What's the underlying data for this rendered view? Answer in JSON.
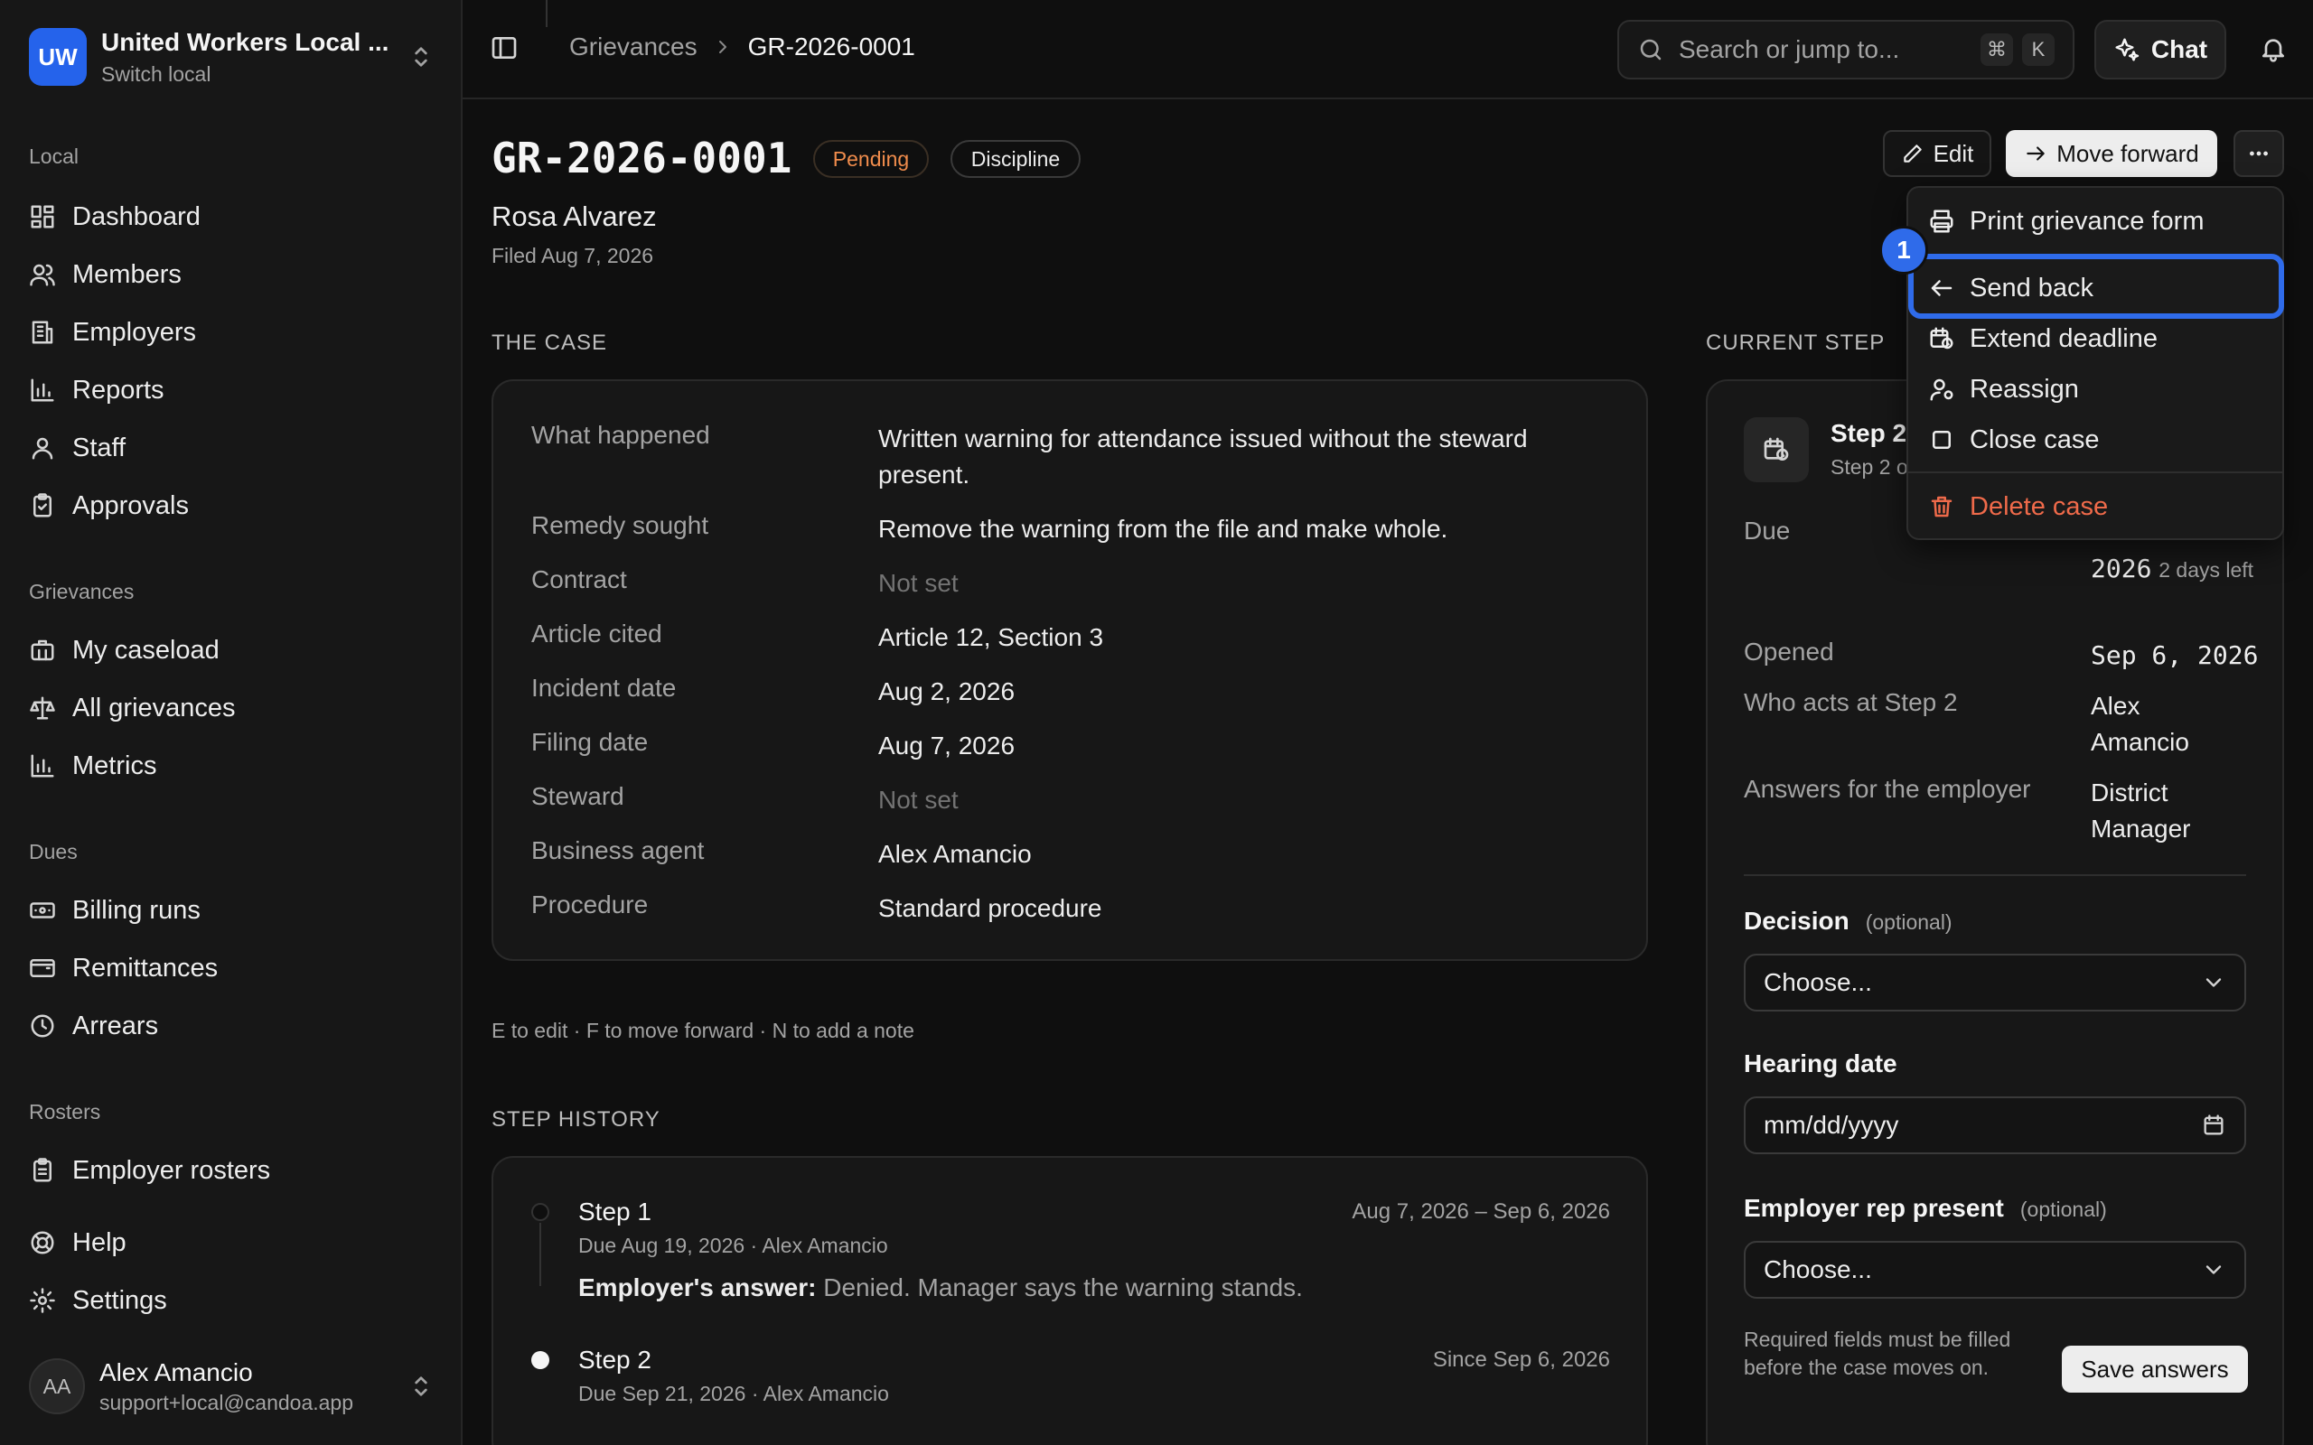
{
  "org": {
    "initials": "UW",
    "name": "United Workers Local ...",
    "switch_label": "Switch local"
  },
  "sidebar": {
    "local_label": "Local",
    "local_items": [
      {
        "label": "Dashboard",
        "icon": "dashboard-icon"
      },
      {
        "label": "Members",
        "icon": "members-icon"
      },
      {
        "label": "Employers",
        "icon": "building-icon"
      },
      {
        "label": "Reports",
        "icon": "bar-chart-icon"
      },
      {
        "label": "Staff",
        "icon": "user-icon"
      },
      {
        "label": "Approvals",
        "icon": "clipboard-check-icon"
      }
    ],
    "grievances_label": "Grievances",
    "grievance_items": [
      {
        "label": "My caseload",
        "icon": "briefcase-icon"
      },
      {
        "label": "All grievances",
        "icon": "scale-icon"
      },
      {
        "label": "Metrics",
        "icon": "bar-chart-icon"
      }
    ],
    "dues_label": "Dues",
    "dues_items": [
      {
        "label": "Billing runs",
        "icon": "banknote-icon"
      },
      {
        "label": "Remittances",
        "icon": "wallet-icon"
      },
      {
        "label": "Arrears",
        "icon": "clock-icon"
      }
    ],
    "rosters_label": "Rosters",
    "roster_items": [
      {
        "label": "Employer rosters",
        "icon": "clipboard-list-icon"
      }
    ],
    "footer_items": [
      {
        "label": "Help",
        "icon": "lifebuoy-icon"
      },
      {
        "label": "Settings",
        "icon": "gear-icon"
      }
    ]
  },
  "user": {
    "initials": "AA",
    "name": "Alex Amancio",
    "email": "support+local@candoa.app"
  },
  "topbar": {
    "breadcrumb_parent": "Grievances",
    "breadcrumb_current": "GR-2026-0001",
    "search_placeholder": "Search or jump to...",
    "kbd_mod": "⌘",
    "kbd_key": "K",
    "chat_label": "Chat"
  },
  "header": {
    "case_id": "GR-2026-0001",
    "status_badge": "Pending",
    "type_badge": "Discipline",
    "member_name": "Rosa Alvarez",
    "filed": "Filed Aug 7, 2026",
    "edit_label": "Edit",
    "move_forward_label": "Move forward"
  },
  "the_case": {
    "section_label": "THE CASE",
    "rows": [
      {
        "label": "What happened",
        "value": "Written warning for attendance issued without the steward present."
      },
      {
        "label": "Remedy sought",
        "value": "Remove the warning from the file and make whole."
      },
      {
        "label": "Contract",
        "value": "Not set"
      },
      {
        "label": "Article cited",
        "value": "Article 12, Section 3"
      },
      {
        "label": "Incident date",
        "value": "Aug 2, 2026"
      },
      {
        "label": "Filing date",
        "value": "Aug 7, 2026"
      },
      {
        "label": "Steward",
        "value": "Not set"
      },
      {
        "label": "Business agent",
        "value": "Alex Amancio"
      },
      {
        "label": "Procedure",
        "value": "Standard procedure"
      }
    ]
  },
  "shortcuts_hint": "E to edit · F to move forward · N to add a note",
  "step_history": {
    "section_label": "STEP HISTORY",
    "steps": [
      {
        "title": "Step 1",
        "sub": "Due Aug 19, 2026 · Alex Amancio",
        "dates": "Aug 7, 2026 – Sep 6, 2026",
        "answer_label": "Employer's answer:",
        "answer": "Denied. Manager says the warning stands."
      },
      {
        "title": "Step 2",
        "sub": "Due Sep 21, 2026 · Alex Amancio",
        "dates": "Since Sep 6, 2026"
      }
    ]
  },
  "current_step": {
    "section_label": "CURRENT STEP",
    "title": "Step 2",
    "sub": "Step 2 o",
    "due_label": "Due",
    "due_value_partial": "2026",
    "due_left": "2 days left",
    "opened_label": "Opened",
    "opened_value": "Sep 6, 2026",
    "who_acts_label": "Who acts at Step 2",
    "who_acts_value": "Alex Amancio",
    "answers_for_label": "Answers for the employer",
    "answers_for_value": "District Manager",
    "decision_label": "Decision",
    "decision_optional": "(optional)",
    "decision_value": "Choose...",
    "hearing_label": "Hearing date",
    "hearing_placeholder": "mm/dd/yyyy",
    "rep_label": "Employer rep present",
    "rep_optional": "(optional)",
    "rep_value": "Choose...",
    "required_note": "Required fields must be filled before the case moves on.",
    "save_label": "Save answers"
  },
  "menu": {
    "items": [
      {
        "label": "Print grievance form",
        "icon": "printer-icon"
      },
      {
        "label": "Send back",
        "icon": "arrow-left-icon"
      },
      {
        "label": "Extend deadline",
        "icon": "calendar-clock-icon"
      },
      {
        "label": "Reassign",
        "icon": "user-cog-icon"
      },
      {
        "label": "Close case",
        "icon": "square-icon"
      },
      {
        "label": "Delete case",
        "icon": "trash-icon"
      }
    ]
  },
  "step_marker": "1",
  "colors": {
    "accent": "#2563eb",
    "pending": "#f08c4c",
    "danger": "#ef6a4a",
    "focus": "#2f6bea"
  }
}
